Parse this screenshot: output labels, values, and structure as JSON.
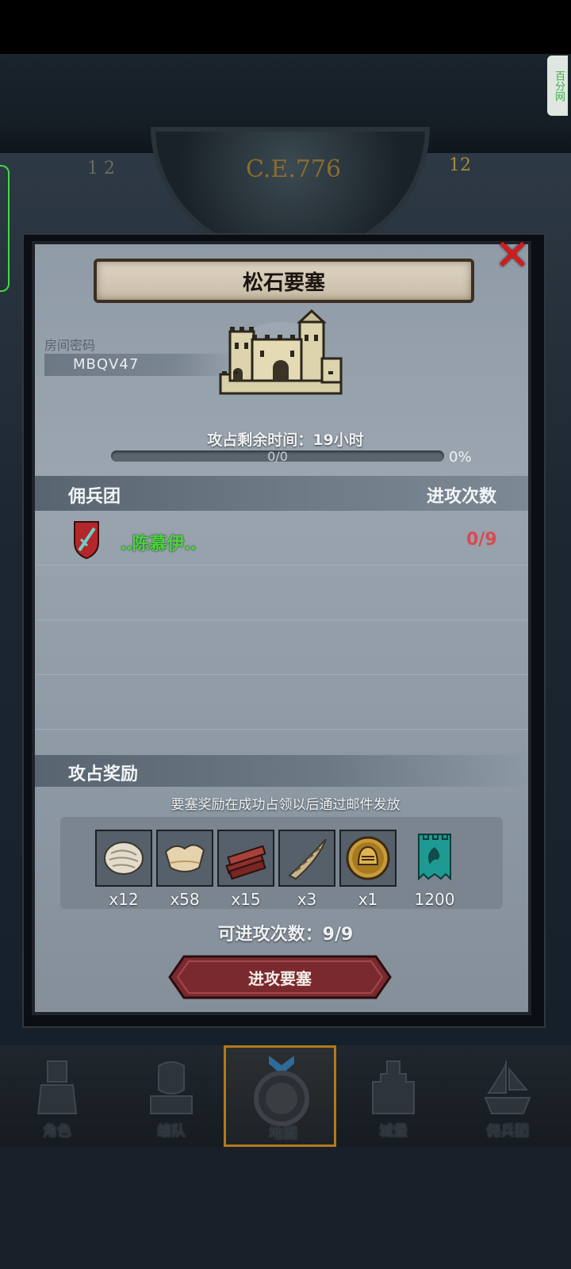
{
  "status": {
    "side_tag": "百分网"
  },
  "backdrop": {
    "era_text": "C.E.776",
    "dial_left": "1 2",
    "dial_right": "12"
  },
  "dialog": {
    "title": "松石要塞",
    "room_label": "房间密码",
    "room_code": "MBQV47",
    "time_remaining": "攻占剩余时间：19小时",
    "progress": {
      "label": "0/0",
      "percent_label": "0%",
      "fraction": 0
    },
    "table": {
      "col_left": "佣兵团",
      "col_right": "进攻次数",
      "rows": [
        {
          "name": "‥陈慕伊‥",
          "count": "0/9",
          "name_color": "#4cd437",
          "count_color": "#d94a52"
        }
      ]
    },
    "reward": {
      "title": "攻占奖励",
      "note": "要塞奖励在成功占领以后通过邮件发放",
      "items": [
        {
          "icon": "fur-pelt-icon",
          "qty": "x12"
        },
        {
          "icon": "leather-hide-icon",
          "qty": "x58"
        },
        {
          "icon": "wood-planks-icon",
          "qty": "x15"
        },
        {
          "icon": "horn-icon",
          "qty": "x3"
        },
        {
          "icon": "knight-helmet-coin-icon",
          "qty": "x1"
        },
        {
          "icon": "castle-banner-icon",
          "qty": "1200"
        }
      ]
    },
    "attacks_left": "可进攻次数：9/9",
    "attack_button": "进攻要塞",
    "close_icon": "close-x-icon"
  },
  "nav": {
    "items": [
      {
        "label": "角色",
        "icon": "knight-character-icon",
        "active": false
      },
      {
        "label": "编队",
        "icon": "squad-helmet-icon",
        "active": false
      },
      {
        "label": "地图",
        "icon": "map-compass-icon",
        "active": true
      },
      {
        "label": "城堡",
        "icon": "castle-icon",
        "active": false
      },
      {
        "label": "佣兵团",
        "icon": "mercenary-ship-icon",
        "active": false
      }
    ]
  },
  "colors": {
    "accent_gold": "#b07a1e",
    "close_red": "#d41b1b",
    "button_red": "#7a2a2e"
  }
}
